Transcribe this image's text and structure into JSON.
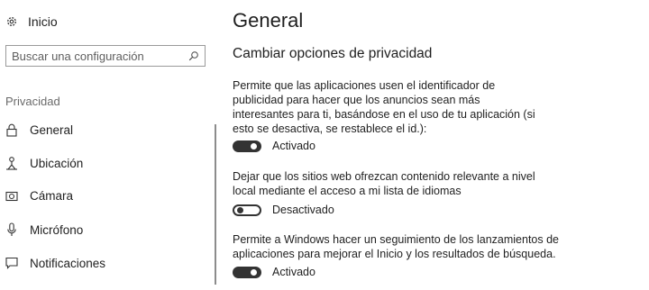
{
  "sidebar": {
    "home_label": "Inicio",
    "search_placeholder": "Buscar una configuración",
    "section_label": "Privacidad",
    "items": [
      {
        "label": "General",
        "icon": "lock-icon"
      },
      {
        "label": "Ubicación",
        "icon": "location-icon"
      },
      {
        "label": "Cámara",
        "icon": "camera-icon"
      },
      {
        "label": "Micrófono",
        "icon": "microphone-icon"
      },
      {
        "label": "Notificaciones",
        "icon": "notification-icon"
      }
    ]
  },
  "main": {
    "title": "General",
    "subtitle": "Cambiar opciones de privacidad",
    "settings": [
      {
        "description": "Permite que las aplicaciones usen el identificador de publicidad para hacer que los anuncios sean más interesantes para ti, basándose en el uso de tu aplicación (si esto se desactiva, se restablece el id.):",
        "state_label": "Activado",
        "on": true
      },
      {
        "description": "Dejar que los sitios web ofrezcan contenido relevante a nivel local mediante el acceso a mi lista de idiomas",
        "state_label": "Desactivado",
        "on": false
      },
      {
        "description": "Permite a Windows hacer un seguimiento de los lanzamientos de aplicaciones para mejorar el Inicio y los resultados de búsqueda.",
        "state_label": "Activado",
        "on": true
      }
    ]
  }
}
